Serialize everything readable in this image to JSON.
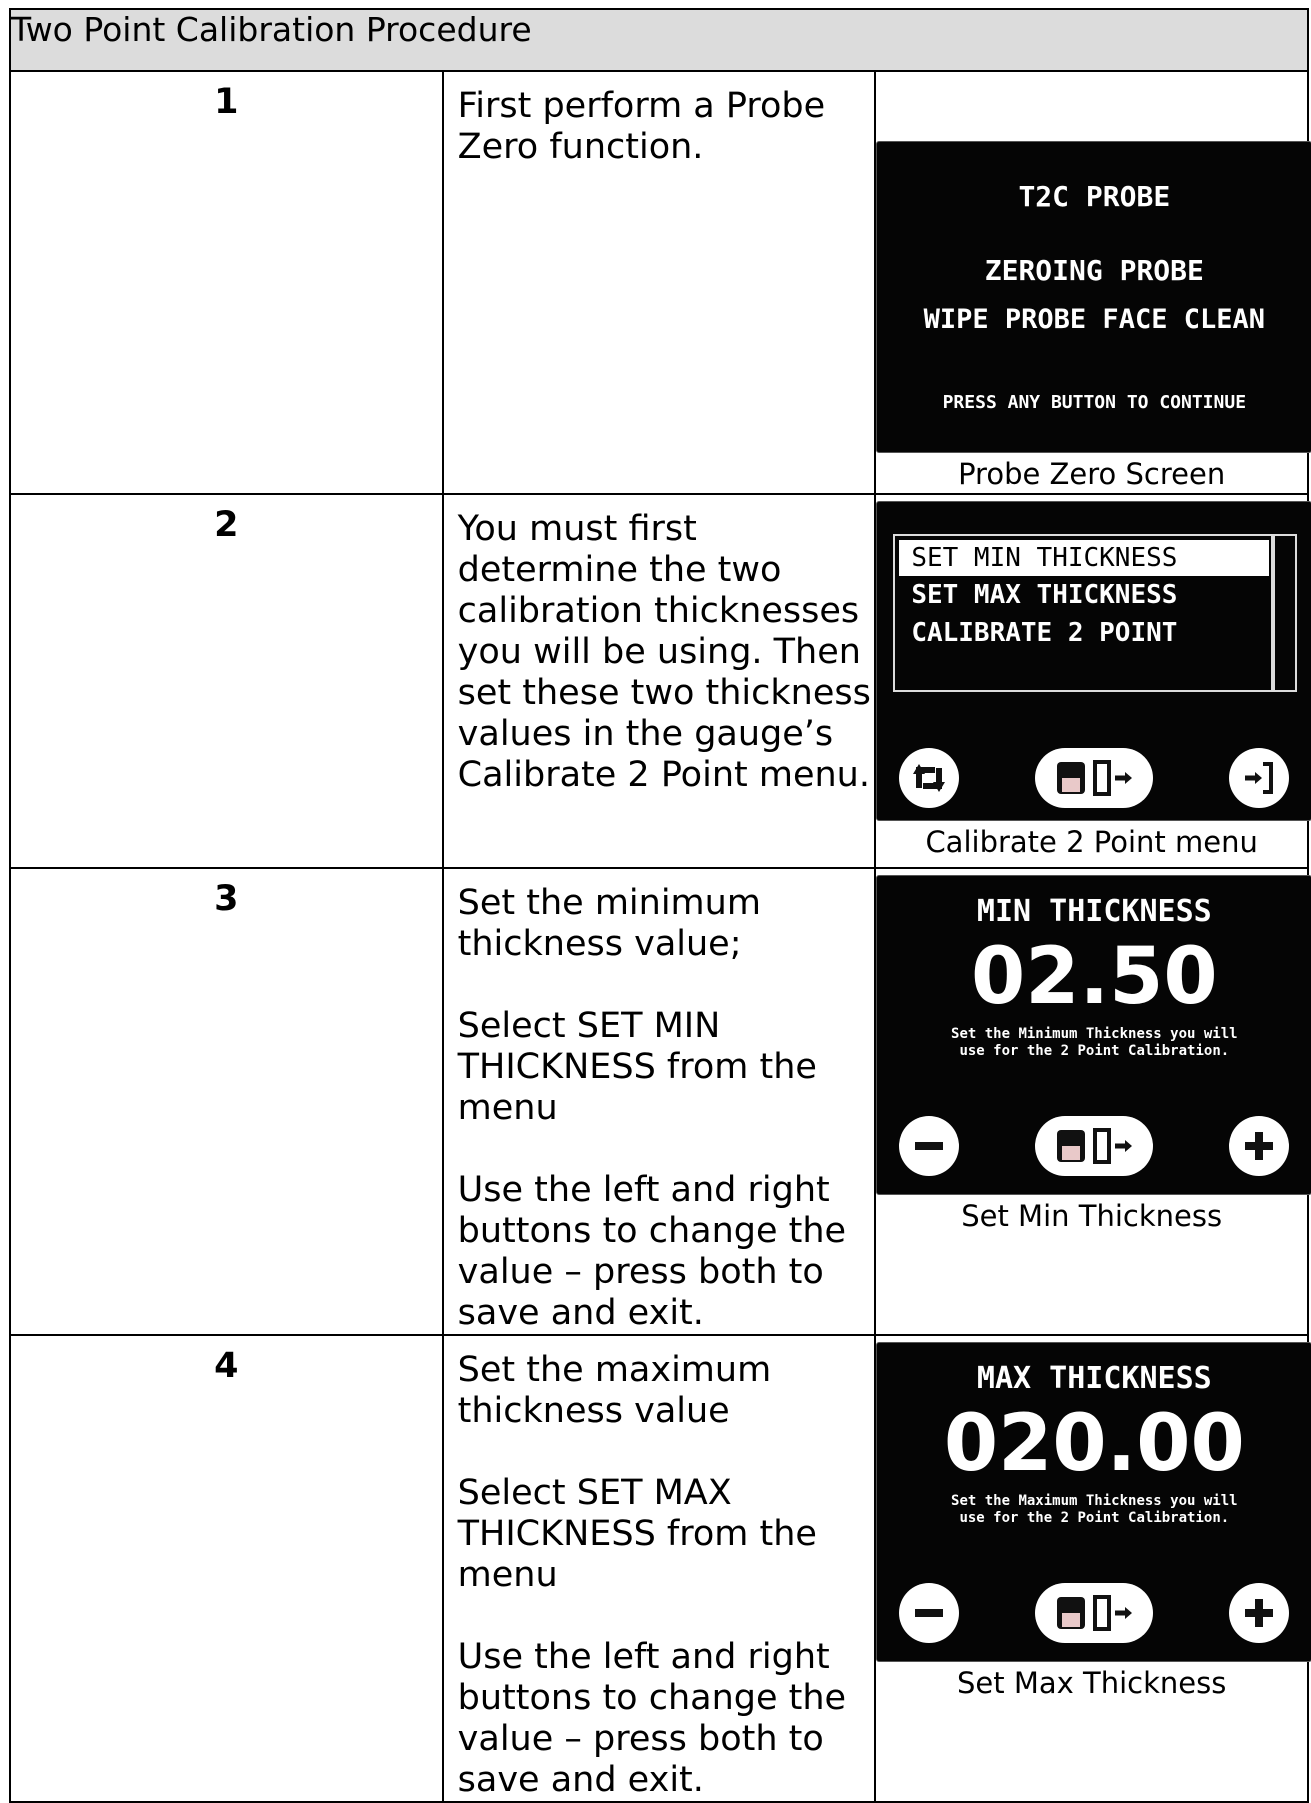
{
  "title": "Two Point Calibration Procedure",
  "steps": [
    {
      "number": "1",
      "paragraphs": [
        "First perform a Probe Zero function."
      ],
      "caption": "Probe Zero Screen",
      "screen": {
        "line1": "T2C PROBE",
        "line2": "ZEROING PROBE",
        "line3": "WIPE PROBE FACE CLEAN",
        "line4": "PRESS ANY BUTTON TO CONTINUE"
      }
    },
    {
      "number": "2",
      "paragraphs": [
        "You must first determine the two calibration thicknesses you will be using. Then set these two thickness values in the gauge’s Calibrate 2 Point menu."
      ],
      "caption": "Calibrate 2 Point menu",
      "screen": {
        "items": [
          "SET MIN THICKNESS",
          "SET MAX THICKNESS",
          "CALIBRATE 2 POINT"
        ],
        "icons": [
          "cycle-icon",
          "save-exit-icon",
          "enter-icon"
        ]
      }
    },
    {
      "number": "3",
      "paragraphs": [
        "Set the minimum thickness value;",
        "Select SET MIN THICKNESS from the menu",
        "Use the left and right buttons to change the value – press both to save and exit."
      ],
      "caption": "Set Min Thickness",
      "screen": {
        "heading": "MIN THICKNESS",
        "value": "02.50",
        "help1": "Set the Minimum Thickness you will",
        "help2": "use for the 2 Point Calibration.",
        "icons": [
          "minus-icon",
          "save-exit-icon",
          "plus-icon"
        ]
      }
    },
    {
      "number": "4",
      "paragraphs": [
        "Set the maximum thickness value",
        "Select SET MAX THICKNESS from the menu",
        "Use the left and right buttons to change the value – press both to save and exit."
      ],
      "caption": "Set Max Thickness",
      "screen": {
        "heading": "MAX THICKNESS",
        "value": "020.00",
        "help1": "Set the Maximum Thickness you will",
        "help2": "use for the 2 Point Calibration.",
        "icons": [
          "minus-icon",
          "save-exit-icon",
          "plus-icon"
        ]
      }
    }
  ]
}
